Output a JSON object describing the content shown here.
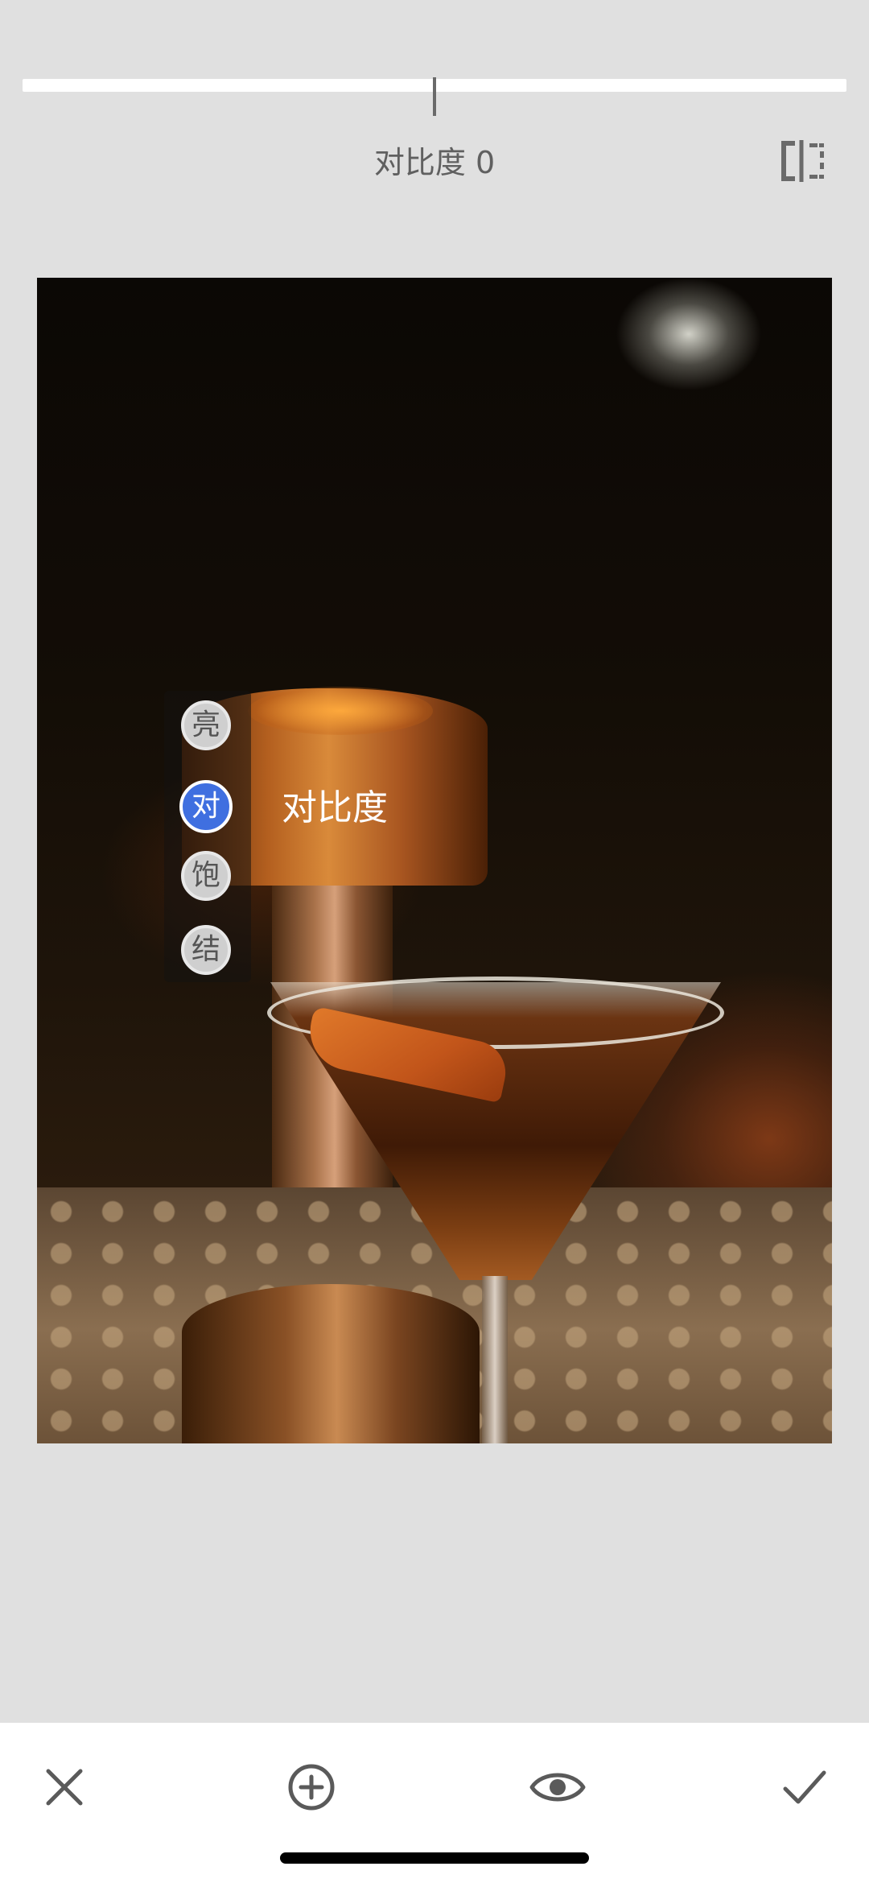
{
  "adjustment": {
    "label": "对比度 0",
    "value": 0,
    "range": [
      -100,
      100
    ]
  },
  "toolbar_top": {
    "compare_icon": "compare-split-icon"
  },
  "tool_menu": {
    "items": [
      {
        "glyph": "亮",
        "selected": false
      },
      {
        "glyph": "对",
        "selected": true
      },
      {
        "glyph": "饱",
        "selected": false
      },
      {
        "glyph": "结",
        "selected": false
      }
    ],
    "selected_label": "对比度",
    "accent_color": "#3f6fe0"
  },
  "bottom_bar": {
    "icons": [
      "close-icon",
      "add-circle-icon",
      "eye-icon",
      "check-icon"
    ]
  },
  "colors": {
    "background": "#e0e0e0",
    "bar_background": "#ffffff",
    "icon_color": "#5a5a5a"
  }
}
